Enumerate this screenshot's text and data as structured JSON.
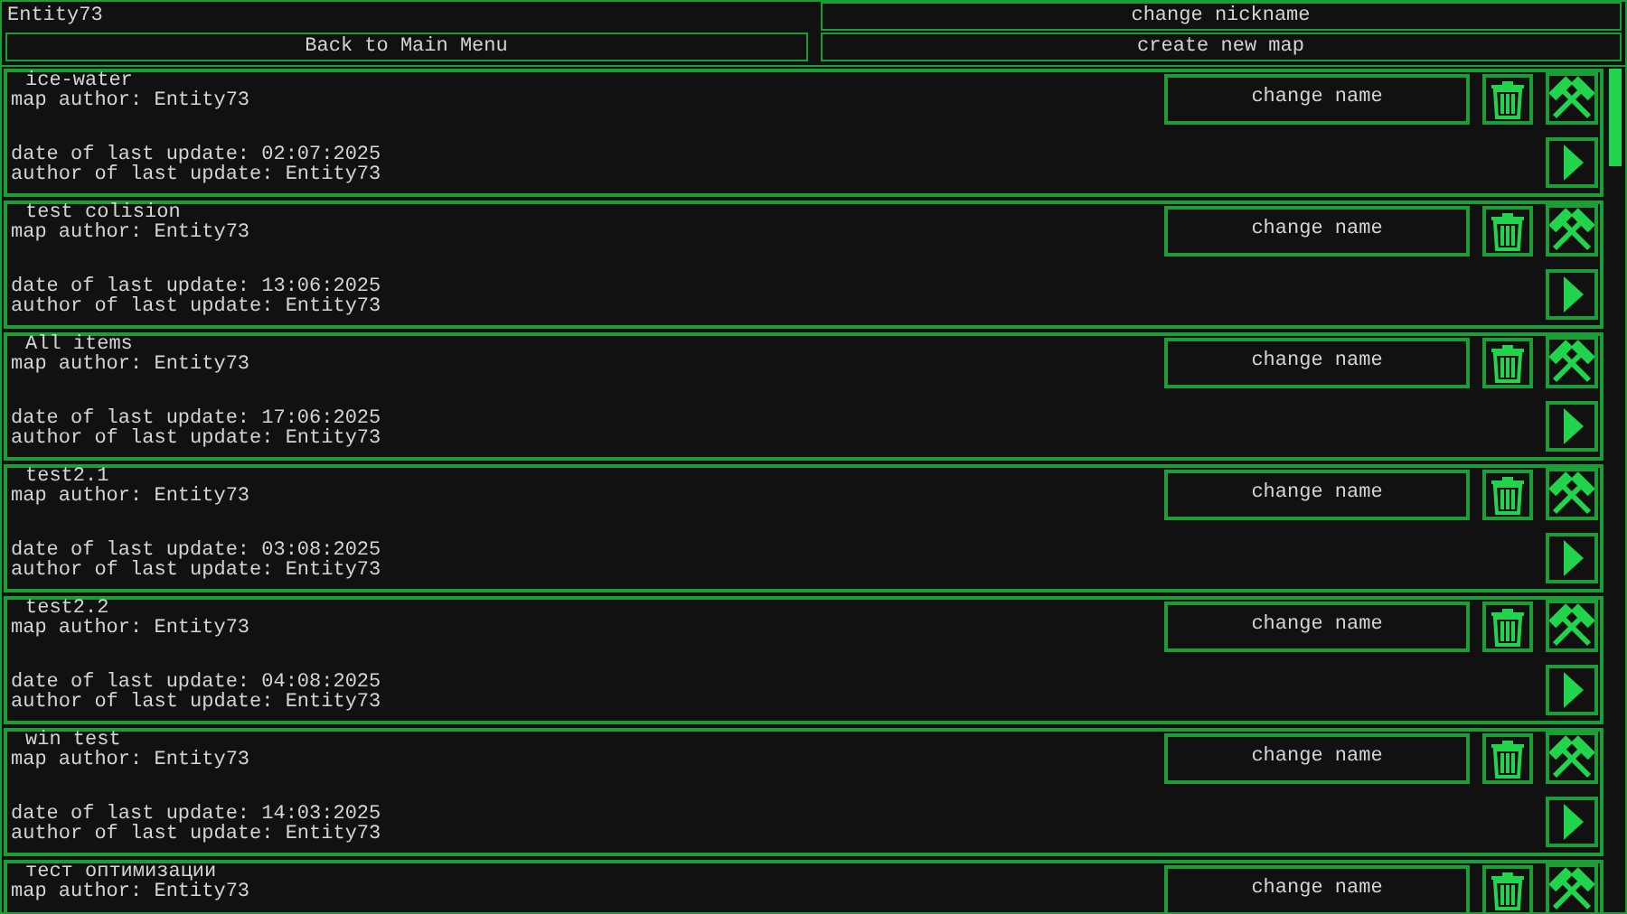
{
  "user": {
    "nickname": "Entity73"
  },
  "top_buttons": [
    {
      "label": "change nickname"
    },
    {
      "label": "Back to Main Menu"
    },
    {
      "label": "create new map"
    }
  ],
  "maps": [
    {
      "title": "ice-water",
      "author": "map author: Entity73",
      "date": "date of last update: 02:07:2025",
      "updated_by": "author of last update: Entity73",
      "rename": "change name"
    },
    {
      "title": "test colision",
      "author": "map author: Entity73",
      "date": "date of last update: 13:06:2025",
      "updated_by": "author of last update: Entity73",
      "rename": "change name"
    },
    {
      "title": "All items",
      "author": "map author: Entity73",
      "date": "date of last update: 17:06:2025",
      "updated_by": "author of last update: Entity73",
      "rename": "change name"
    },
    {
      "title": "test2.1",
      "author": "map author: Entity73",
      "date": "date of last update: 03:08:2025",
      "updated_by": "author of last update: Entity73",
      "rename": "change name"
    },
    {
      "title": "test2.2",
      "author": "map author: Entity73",
      "date": "date of last update: 04:08:2025",
      "updated_by": "author of last update: Entity73",
      "rename": "change name"
    },
    {
      "title": "win test",
      "author": "map author: Entity73",
      "date": "date of last update: 14:03:2025",
      "updated_by": "author of last update: Entity73",
      "rename": "change name"
    },
    {
      "title": "тест оптимизации",
      "author": "map author: Entity73",
      "rename": "change name"
    }
  ]
}
